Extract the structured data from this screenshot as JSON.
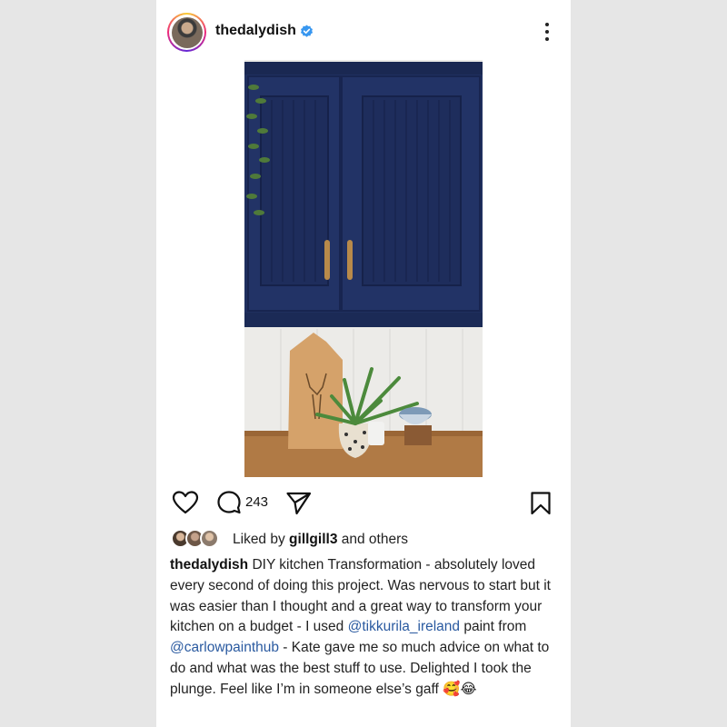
{
  "post": {
    "username": "thedalydish",
    "verified": true,
    "comment_count": "243",
    "liked_by_prefix": "Liked by ",
    "liked_by_user": "gillgill3",
    "liked_by_suffix": " and others",
    "caption_user": "thedalydish",
    "caption_part1": " DIY kitchen Transformation - absolutely loved every second of doing this project. Was nervous to start but it was easier than I thought and a great way to transform your kitchen on a budget - I used ",
    "mention1": "@tikkurila_ireland",
    "caption_part2": " paint from ",
    "mention2": "@carlowpainthub",
    "caption_part3": " - Kate gave me so much advice on what to do and what was the best stuff to use. Delighted I took the plunge. Feel like I’m in someone else’s gaff 🥰😂"
  },
  "icons": {
    "like": "heart-icon",
    "comment": "comment-icon",
    "share": "send-icon",
    "save": "bookmark-icon",
    "more": "more-vertical-icon",
    "verified": "verified-badge-icon"
  },
  "colors": {
    "cabinet_blue": "#1f2f5e",
    "mention_link": "#2a5aa0",
    "verified_blue": "#3897f0"
  }
}
